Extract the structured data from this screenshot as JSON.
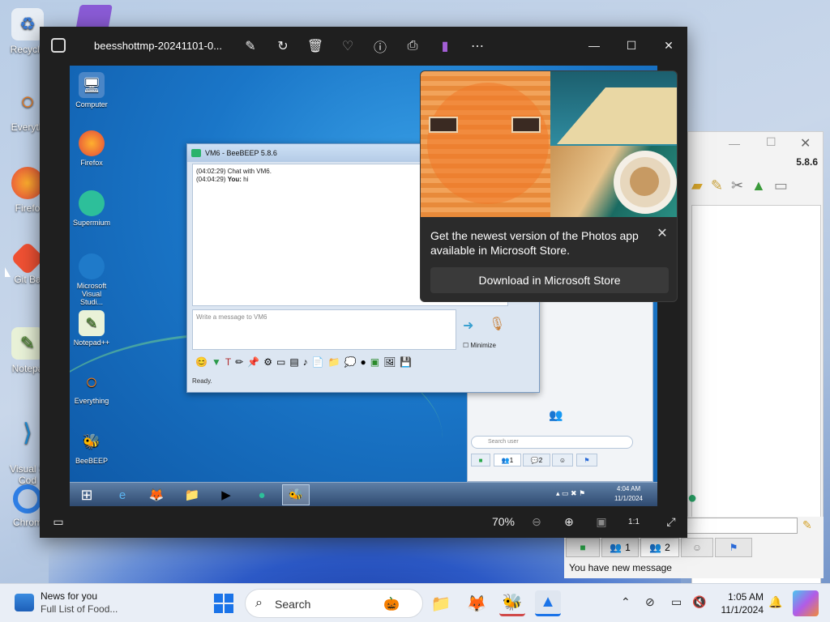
{
  "desktop": {
    "icons": [
      {
        "label": "Recycle"
      },
      {
        "label": "Everyth"
      },
      {
        "label": "Firefo"
      },
      {
        "label": "Git Ba"
      },
      {
        "label": "Notepa"
      },
      {
        "label": "Visual S\nCod"
      },
      {
        "label": "Chrom"
      }
    ]
  },
  "photos": {
    "title": "beesshottmp-20241101-0...",
    "zoom": "70%",
    "window_controls": {
      "minimize": "—",
      "maximize": "☐",
      "close": "✕"
    }
  },
  "inner": {
    "icons": [
      {
        "label": "Computer"
      },
      {
        "label": "Firefox"
      },
      {
        "label": "Supermium"
      },
      {
        "label": "Microsoft Visual Studi..."
      },
      {
        "label": "Notepad++"
      },
      {
        "label": "Everything"
      },
      {
        "label": "BeeBEEP"
      }
    ],
    "chat": {
      "title": "VM6 - BeeBEEP 5.8.6",
      "line1": "(04:02:29)  Chat with VM6.",
      "line2_time": "(04:04:29) ",
      "line2_who": "You:",
      "line2_msg": " hi",
      "placeholder": "Write a message to VM6",
      "minimize": "Minimize",
      "status": "Ready."
    },
    "side": {
      "search_placeholder": "Search user",
      "tab1": "1",
      "tab2": "2"
    },
    "clock_time": "4:04 AM",
    "clock_date": "11/1/2024"
  },
  "toast": {
    "message": "Get the newest version of the Photos app available in Microsoft Store.",
    "button": "Download in Microsoft Store"
  },
  "outer_beebeep": {
    "version": "5.8.6",
    "tab1": "1",
    "tab2": "2",
    "new_message": "You have new message"
  },
  "taskbar": {
    "news_title": "News for you",
    "news_sub": "Full List of Food...",
    "search_label": "Search",
    "time": "1:05 AM",
    "date": "11/1/2024"
  }
}
